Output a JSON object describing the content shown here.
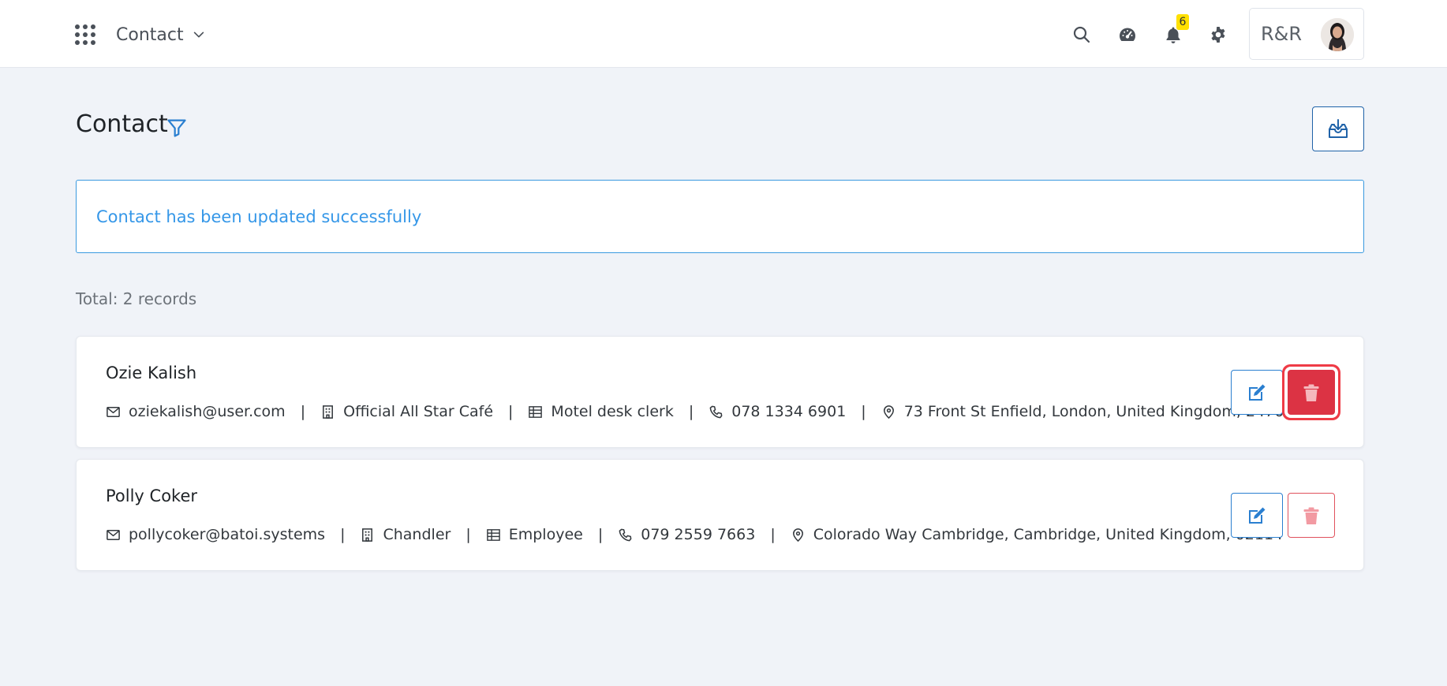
{
  "app": {
    "module_label": "Contact",
    "notification_count": "6",
    "user_initials": "R&R"
  },
  "page": {
    "title": "Contact",
    "alert_message": "Contact has been updated successfully",
    "total_label": "Total: 2 records"
  },
  "contacts": [
    {
      "name": "Ozie Kalish",
      "email": "oziekalish@user.com",
      "company": "Official All Star Café",
      "position": "Motel desk clerk",
      "phone": "078 1334 6901",
      "address": "73 Front St Enfield, London, United Kingdom, 2470"
    },
    {
      "name": "Polly Coker",
      "email": "pollycoker@batoi.systems",
      "company": "Chandler",
      "position": "Employee",
      "phone": "079 2559 7663",
      "address": "Colorado Way Cambridge, Cambridge, United Kingdom, 02114"
    }
  ],
  "icons": {
    "apps": "apps-grid-icon",
    "search": "search-icon",
    "dashboard": "speedometer-icon",
    "notifications": "bell-icon",
    "settings": "gear-icon",
    "filter": "filter-icon",
    "export": "download-tray-icon",
    "edit": "edit-icon",
    "delete": "trash-icon"
  },
  "colors": {
    "primary": "#1f62a8",
    "alert_text": "#3597e8",
    "danger": "#dc3344",
    "badge": "#ffe000",
    "background": "#f0f3f8"
  }
}
